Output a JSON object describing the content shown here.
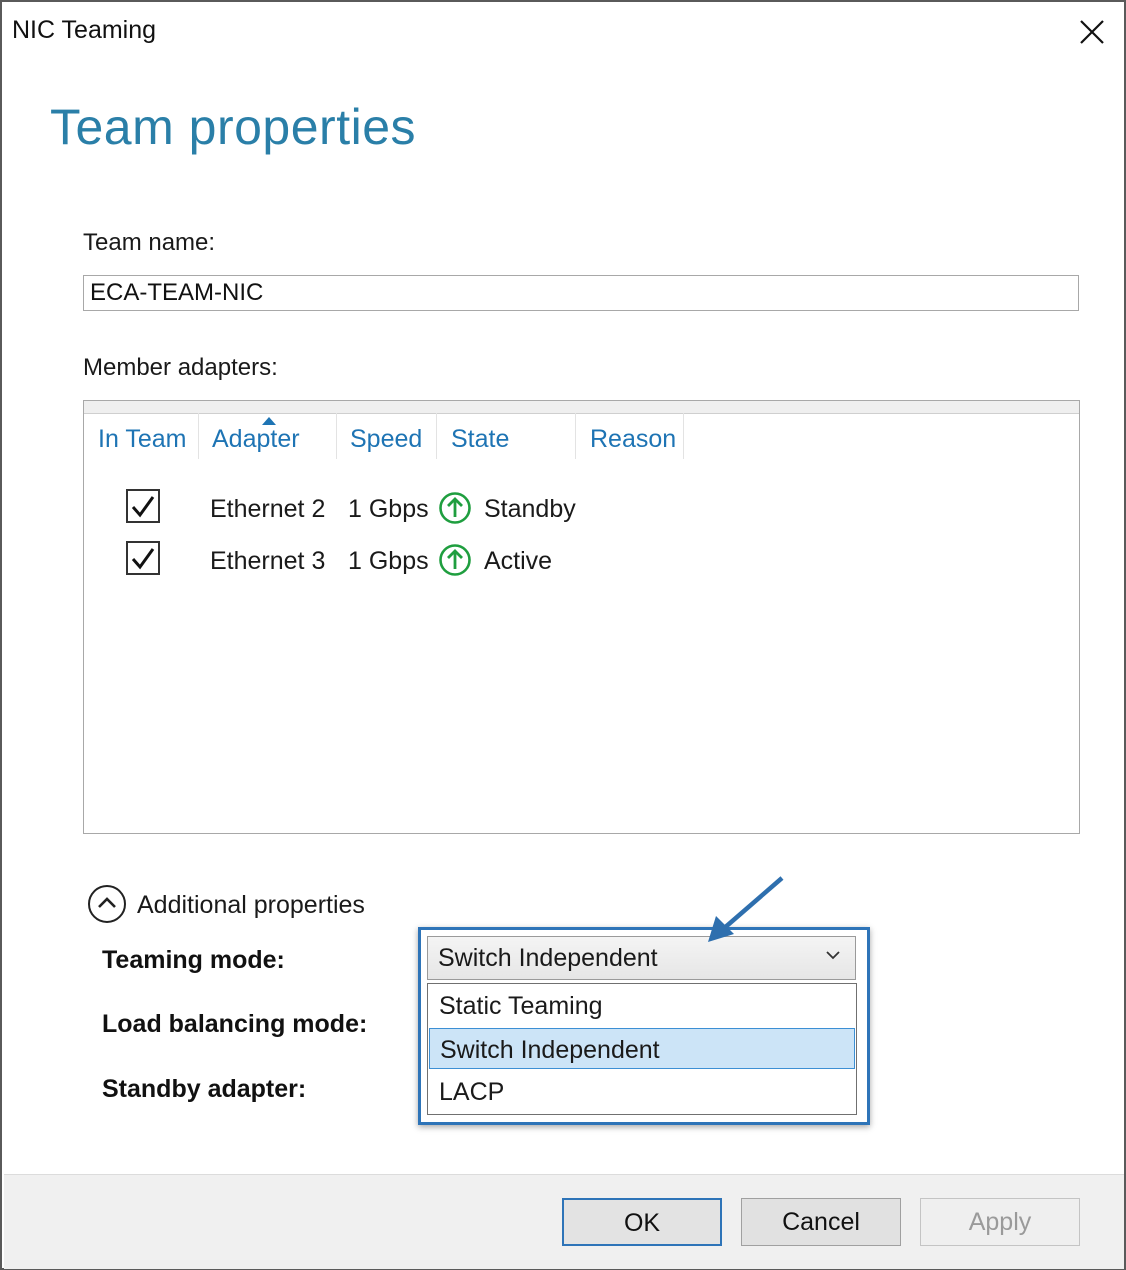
{
  "window": {
    "title": "NIC Teaming"
  },
  "page": {
    "heading": "Team properties"
  },
  "team_name": {
    "label": "Team name:",
    "value": "ECA-TEAM-NIC"
  },
  "members": {
    "label": "Member adapters:",
    "columns": [
      "In Team",
      "Adapter",
      "Speed",
      "State",
      "Reason"
    ],
    "sorted_column": "Adapter",
    "rows": [
      {
        "in_team": true,
        "adapter": "Ethernet 2",
        "speed": "1 Gbps",
        "state_icon": "up-arrow-icon",
        "state": "Standby",
        "reason": ""
      },
      {
        "in_team": true,
        "adapter": "Ethernet 3",
        "speed": "1 Gbps",
        "state_icon": "up-arrow-icon",
        "state": "Active",
        "reason": ""
      }
    ]
  },
  "additional": {
    "toggle_label": "Additional properties",
    "teaming_mode_label": "Teaming mode:",
    "load_balancing_label": "Load balancing mode:",
    "standby_adapter_label": "Standby adapter:",
    "teaming_mode_value": "Switch Independent",
    "teaming_mode_options": [
      "Static Teaming",
      "Switch Independent",
      "LACP"
    ],
    "selected_option": "Switch Independent"
  },
  "buttons": {
    "ok": "OK",
    "cancel": "Cancel",
    "apply": "Apply"
  },
  "colors": {
    "heading": "#2a7fa8",
    "column_header": "#1e74b4",
    "callout_border": "#2e74b8",
    "selected_option_bg": "#cce4f7",
    "status_up": "#1f9e3f"
  }
}
